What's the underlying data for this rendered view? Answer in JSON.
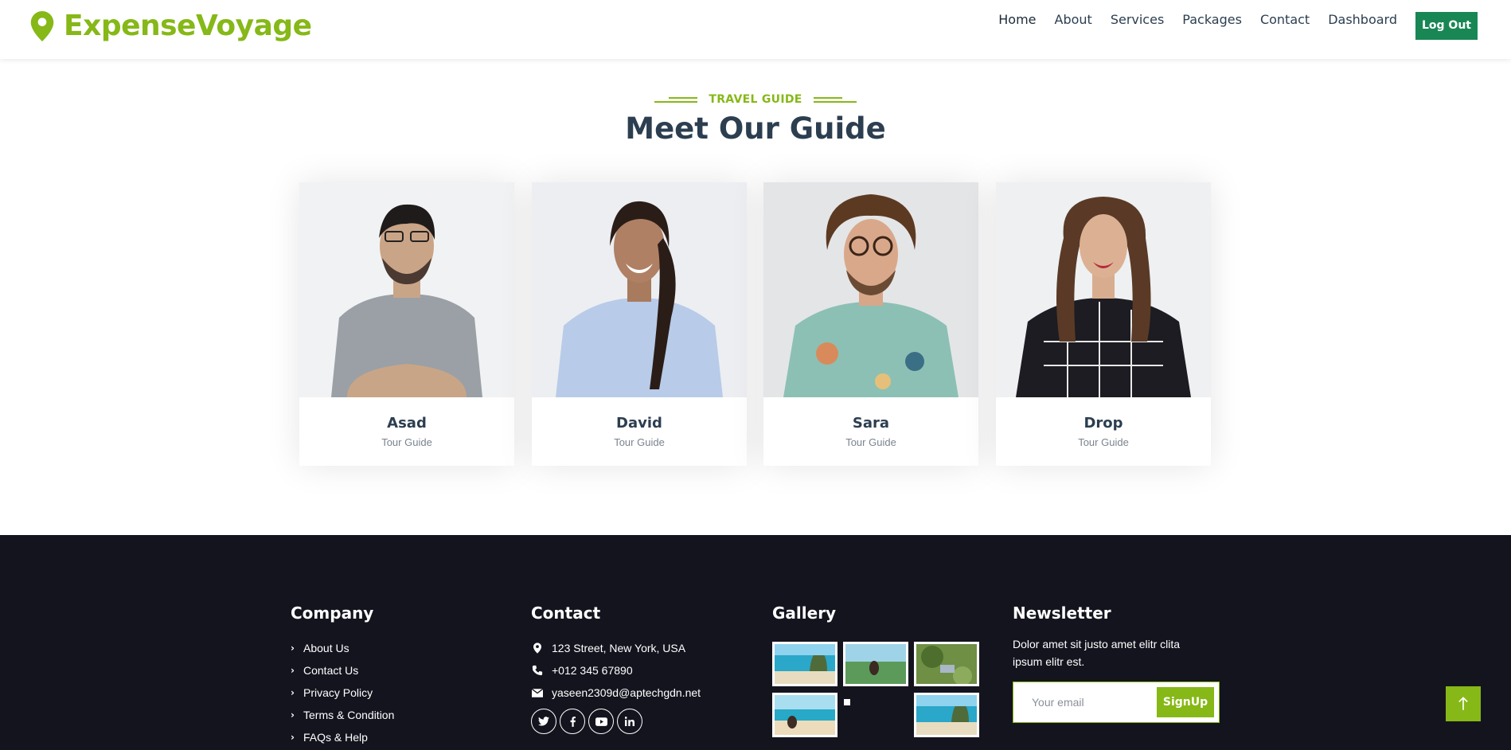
{
  "brand": {
    "name": "ExpenseVoyage",
    "icon": "map-marker-icon",
    "color": "#86b817"
  },
  "nav": {
    "items": [
      "Home",
      "About",
      "Services",
      "Packages",
      "Contact",
      "Dashboard"
    ],
    "logout_label": "Log Out"
  },
  "section": {
    "subtitle": "TRAVEL GUIDE",
    "title": "Meet Our Guide"
  },
  "guides": [
    {
      "name": "Asad",
      "role": "Tour Guide"
    },
    {
      "name": "David",
      "role": "Tour Guide"
    },
    {
      "name": "Sara",
      "role": "Tour Guide"
    },
    {
      "name": "Drop",
      "role": "Tour Guide"
    }
  ],
  "footer": {
    "company": {
      "title": "Company",
      "links": [
        "About Us",
        "Contact Us",
        "Privacy Policy",
        "Terms & Condition",
        "FAQs & Help"
      ]
    },
    "contact": {
      "title": "Contact",
      "address": "123 Street, New York, USA",
      "phone": "+012 345 67890",
      "email": "yaseen2309d@aptechgdn.net",
      "socials": [
        "twitter-icon",
        "facebook-icon",
        "youtube-icon",
        "linkedin-icon"
      ]
    },
    "gallery": {
      "title": "Gallery"
    },
    "newsletter": {
      "title": "Newsletter",
      "text": "Dolor amet sit justo amet elitr clita ipsum elitr est.",
      "placeholder": "Your email",
      "button": "SignUp"
    }
  },
  "colors": {
    "accent": "#86b817",
    "logout": "#198754",
    "footer_bg": "#14141f",
    "heading": "#2c3e50"
  }
}
